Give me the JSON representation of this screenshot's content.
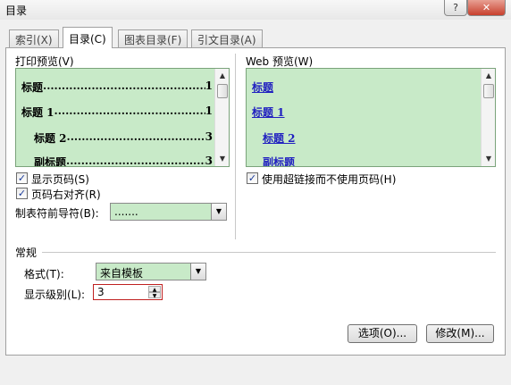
{
  "window": {
    "title": "目录",
    "help_glyph": "?",
    "close_glyph": "✕"
  },
  "tabs": [
    {
      "label": "索引(X)"
    },
    {
      "label": "目录(C)"
    },
    {
      "label": "图表目录(F)"
    },
    {
      "label": "引文目录(A)"
    }
  ],
  "print_preview": {
    "label": "打印预览(V)",
    "lines": [
      {
        "text": "标题",
        "page": "1"
      },
      {
        "text": "标题 1",
        "page": "1"
      },
      {
        "text": "标题 2",
        "page": "3"
      },
      {
        "text": "副标题",
        "page": "3"
      }
    ]
  },
  "web_preview": {
    "label": "Web 预览(W)",
    "links": [
      "标题",
      "标题 1",
      "标题 2",
      "副标题"
    ]
  },
  "options": {
    "show_page_numbers": {
      "label": "显示页码(S)",
      "checked": true,
      "mark": "✓"
    },
    "right_align": {
      "label": "页码右对齐(R)",
      "checked": true,
      "mark": "✓"
    },
    "use_hyperlinks": {
      "label": "使用超链接而不使用页码(H)",
      "checked": true,
      "mark": "✓"
    },
    "tab_leader": {
      "label": "制表符前导符(B):",
      "value": "......."
    }
  },
  "general": {
    "section_label": "常规",
    "format": {
      "label": "格式(T):",
      "value": "来自模板"
    },
    "levels": {
      "label": "显示级别(L):",
      "value": "3"
    }
  },
  "buttons": {
    "options": "选项(O)...",
    "modify": "修改(M)..."
  },
  "glyphs": {
    "up": "▲",
    "down": "▼"
  },
  "colors": {
    "preview_bg": "#c8eac8",
    "link": "#2020c0",
    "spin_border": "#c02020"
  }
}
